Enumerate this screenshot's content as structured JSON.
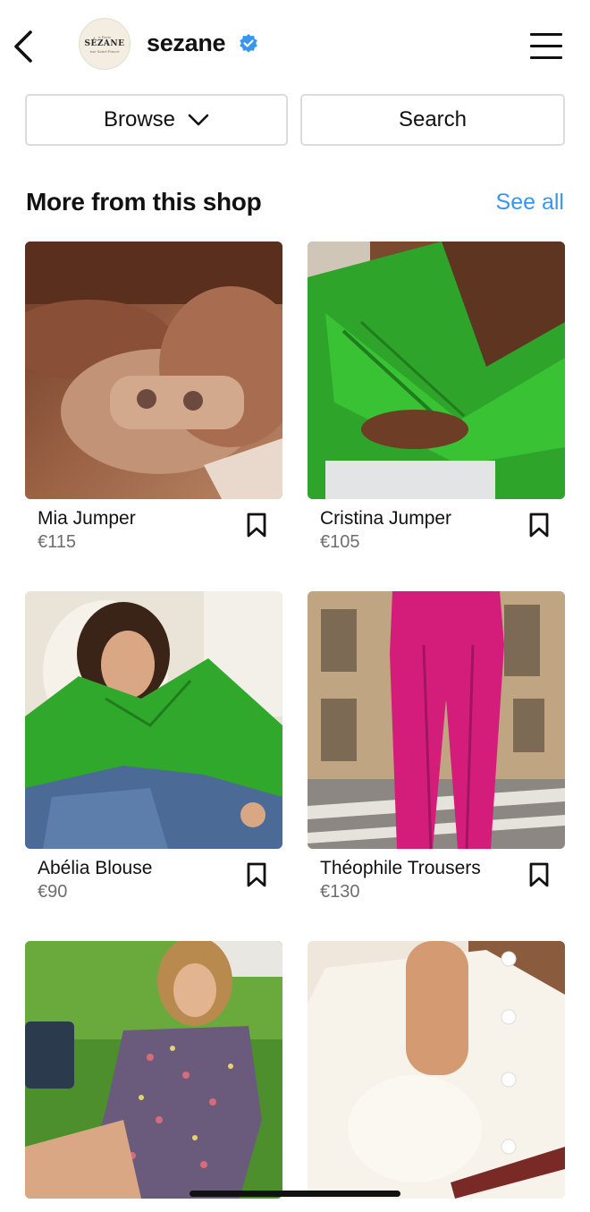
{
  "header": {
    "shop_name": "sezane",
    "logo_lines": [
      "à Paris",
      "SÉZANE",
      "rue Saint-Fiacre"
    ]
  },
  "actions": {
    "browse_label": "Browse",
    "search_label": "Search"
  },
  "section": {
    "title": "More from this shop",
    "see_all": "See all"
  },
  "products": [
    {
      "name": "Mia Jumper",
      "price": "€115"
    },
    {
      "name": "Cristina Jumper",
      "price": "€105"
    },
    {
      "name": "Abélia Blouse",
      "price": "€90"
    },
    {
      "name": "Théophile Trousers",
      "price": "€130"
    },
    {
      "name": "",
      "price": ""
    },
    {
      "name": "",
      "price": ""
    }
  ],
  "colors": {
    "accent": "#3797f0",
    "verified": "#3797f0"
  }
}
